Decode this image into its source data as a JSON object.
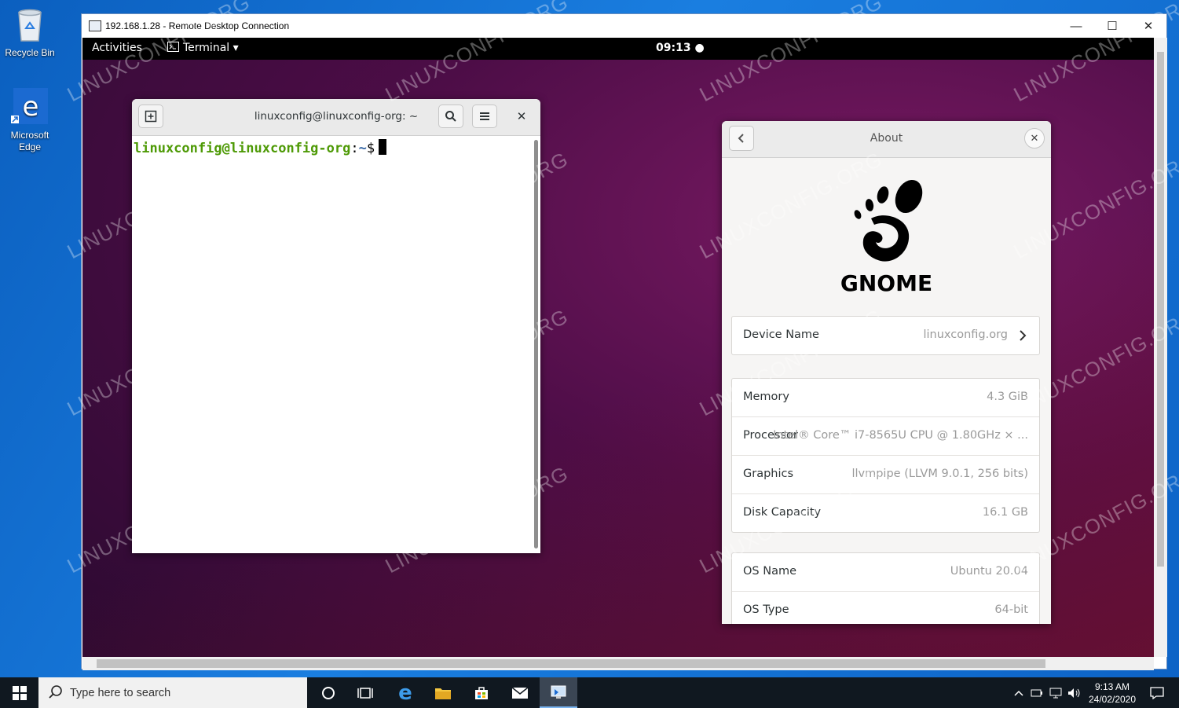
{
  "desktop": {
    "icons": [
      {
        "label": "Recycle Bin"
      },
      {
        "label": "Microsoft Edge"
      }
    ]
  },
  "rdp_window": {
    "title": "192.168.1.28 - Remote Desktop Connection",
    "controls": {
      "minimize": "—",
      "maximize": "☐",
      "close": "✕"
    }
  },
  "gnome": {
    "topbar": {
      "activities": "Activities",
      "app_menu": "Terminal ▾",
      "clock": "09:13 ●"
    },
    "terminal": {
      "title": "linuxconfig@linuxconfig-org: ~",
      "prompt_user": "linuxconfig@linuxconfig-org",
      "prompt_sep": ":",
      "prompt_path": "~",
      "prompt_symbol": "$"
    },
    "about": {
      "title": "About",
      "logo_text": "GNOME",
      "device": {
        "label": "Device Name",
        "value": "linuxconfig.org"
      },
      "hardware": [
        {
          "label": "Memory",
          "value": "4.3 GiB"
        },
        {
          "label": "Processor",
          "value": "Intel® Core™ i7-8565U CPU @ 1.80GHz × ..."
        },
        {
          "label": "Graphics",
          "value": "llvmpipe (LLVM 9.0.1, 256 bits)"
        },
        {
          "label": "Disk Capacity",
          "value": "16.1 GB"
        }
      ],
      "os": [
        {
          "label": "OS Name",
          "value": "Ubuntu 20.04"
        },
        {
          "label": "OS Type",
          "value": "64-bit"
        }
      ]
    }
  },
  "taskbar": {
    "search_placeholder": "Type here to search",
    "time": "9:13 AM",
    "date": "24/02/2020"
  },
  "watermark": "LINUXCONFIG.ORG",
  "colors": {
    "prompt_user": "#4e9a06",
    "prompt_path": "#3465a4",
    "remote_bg": "#4d0d47",
    "taskbar": "#101820"
  }
}
